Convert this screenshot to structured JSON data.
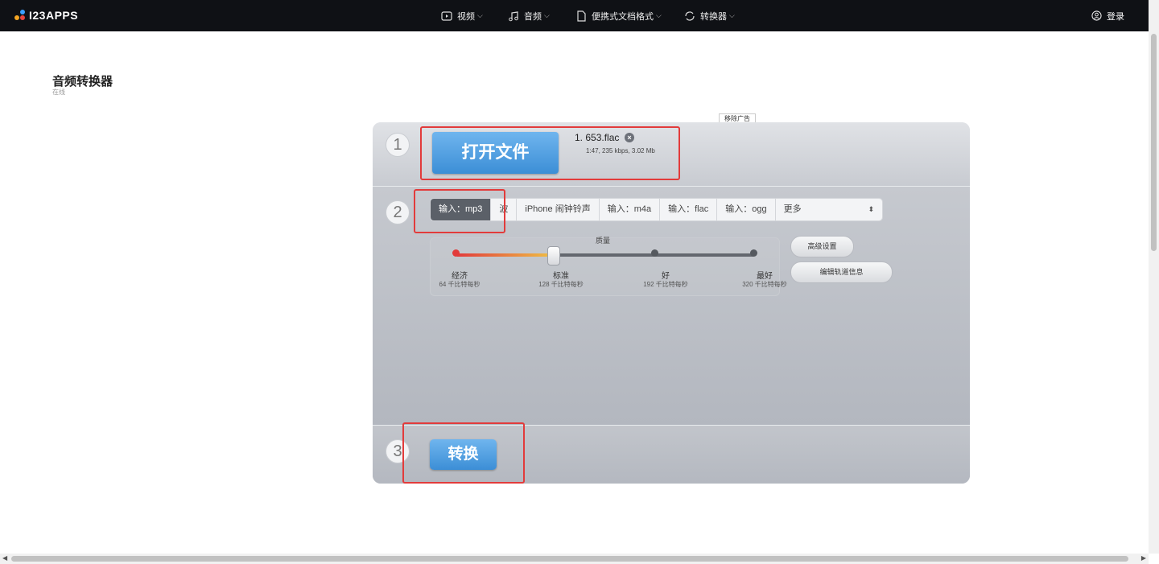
{
  "header": {
    "logo_text": "I23APPS",
    "nav": [
      {
        "label": "视频",
        "icon": "video-icon"
      },
      {
        "label": "音频",
        "icon": "music-note-icon"
      },
      {
        "label": "便携式文档格式",
        "icon": "document-icon"
      },
      {
        "label": "转换器",
        "icon": "convert-icon"
      }
    ],
    "login_label": "登录"
  },
  "page": {
    "title": "音频转换器",
    "subtitle": "在线",
    "remove_ad": "移除广告"
  },
  "converter": {
    "step1": {
      "number": "1",
      "open_button": "打开文件",
      "file_name": "1. 653.flac",
      "file_info": "1:47, 235 kbps, 3.02 Mb"
    },
    "step2": {
      "number": "2",
      "tabs": [
        "输入：mp3",
        "波",
        "iPhone 闹钟铃声",
        "输入：m4a",
        "输入：flac",
        "输入：ogg",
        "更多"
      ],
      "active_tab": "输入：mp3",
      "quality_label": "质量",
      "quality_levels": [
        {
          "name": "经济",
          "rate": "64 千比特每秒"
        },
        {
          "name": "标准",
          "rate": "128 千比特每秒"
        },
        {
          "name": "好",
          "rate": "192 千比特每秒"
        },
        {
          "name": "最好",
          "rate": "320 千比特每秒"
        }
      ],
      "selected_quality": "标准",
      "advanced_button": "高级设置",
      "edit_tags_button": "编辑轨道信息"
    },
    "step3": {
      "number": "3",
      "convert_button": "转换"
    }
  },
  "colors": {
    "topbar": "#0f1115",
    "button_blue": "#3c8ed6",
    "highlight_red": "#e23b3b"
  }
}
